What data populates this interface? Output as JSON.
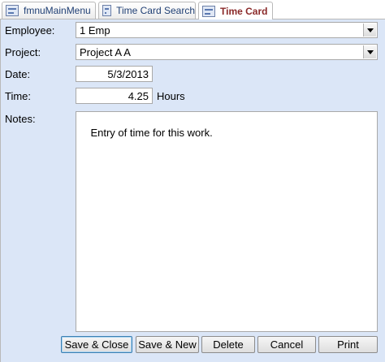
{
  "tabs": [
    {
      "label": "fmnuMainMenu",
      "icon": "form-icon",
      "active": false
    },
    {
      "label": "Time Card Search",
      "icon": "form-icon",
      "active": false
    },
    {
      "label": "Time Card",
      "icon": "form-icon",
      "active": true
    }
  ],
  "form": {
    "employee": {
      "label": "Employee:",
      "value": "1 Emp"
    },
    "project": {
      "label": "Project:",
      "value": "Project A A"
    },
    "date": {
      "label": "Date:",
      "value": "5/3/2013"
    },
    "time": {
      "label": "Time:",
      "value": "4.25",
      "unit": "Hours"
    },
    "notes": {
      "label": "Notes:",
      "value": "Entry of time for this work."
    }
  },
  "buttons": {
    "save_close": "Save & Close",
    "save_new": "Save & New",
    "delete": "Delete",
    "cancel": "Cancel",
    "print": "Print"
  },
  "colors": {
    "form_background": "#dbe6f7",
    "active_tab_text": "#8a2a2a",
    "tab_text": "#1f3f74"
  }
}
